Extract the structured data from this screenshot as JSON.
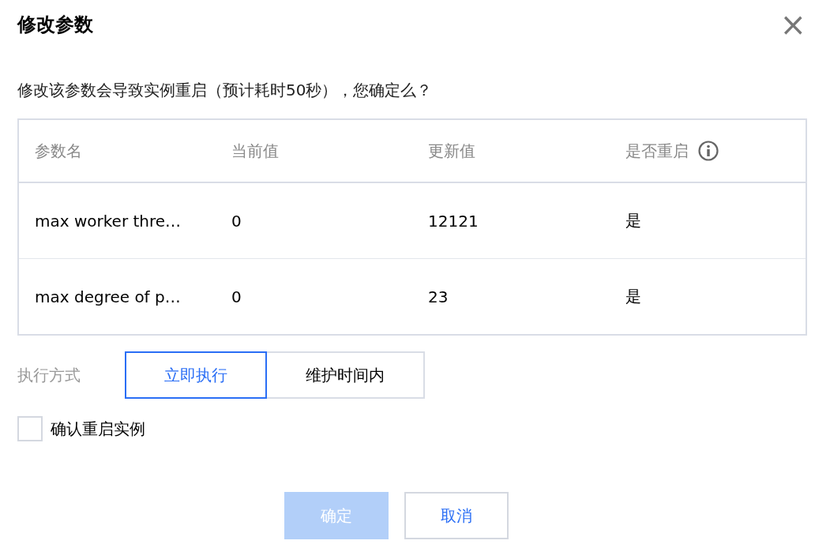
{
  "dialog": {
    "title": "修改参数",
    "close": "×",
    "message": "修改该参数会导致实例重启（预计耗时50秒），您确定么？"
  },
  "table": {
    "columns": [
      "参数名",
      "当前值",
      "更新值",
      "是否重启"
    ],
    "rows": [
      [
        "max worker thre…",
        "0",
        "12121",
        "是"
      ],
      [
        "max degree of p…",
        "0",
        "23",
        "是"
      ]
    ]
  },
  "execution": {
    "label": "执行方式",
    "options": [
      {
        "label": "立即执行",
        "selected": true
      },
      {
        "label": "维护时间内",
        "selected": false
      }
    ]
  },
  "confirm_restart": {
    "label": "确认重启实例",
    "checked": false
  },
  "buttons": [
    {
      "label": "确定",
      "kind": "primary",
      "disabled": true
    },
    {
      "label": "取消",
      "kind": "secondary",
      "disabled": false
    }
  ]
}
